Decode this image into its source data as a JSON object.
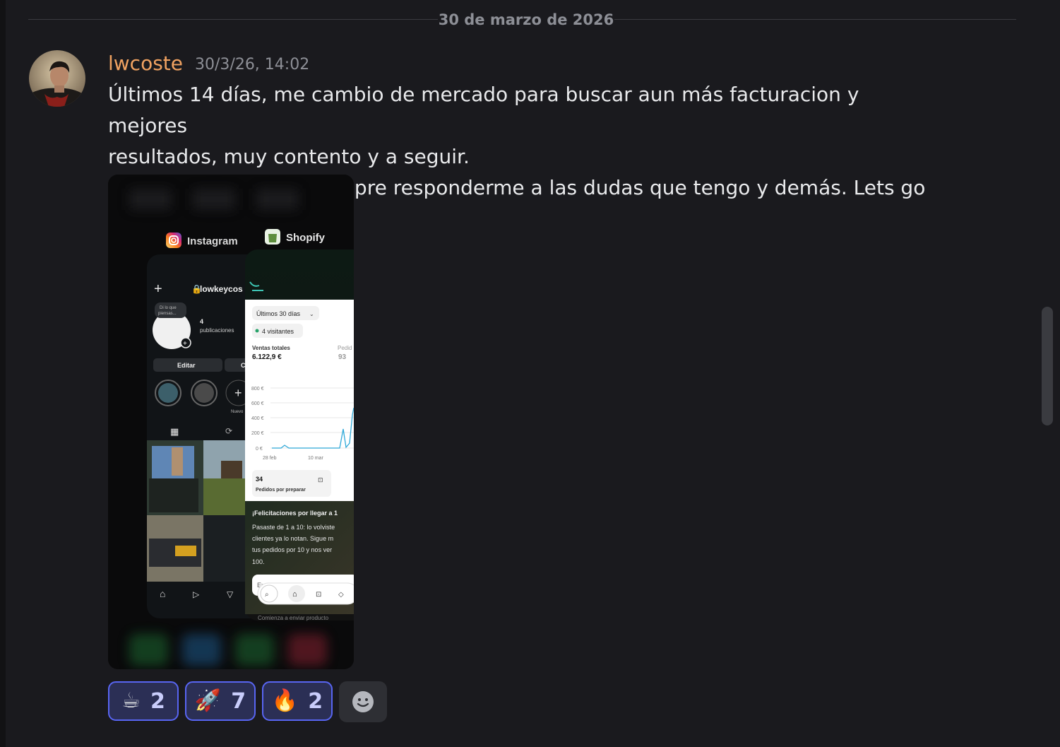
{
  "divider": {
    "date": "30 de marzo de 2026"
  },
  "message": {
    "author": "lwcoste",
    "timestamp": "30/3/26, 14:02",
    "lines": [
      "Últimos 14 días, me cambio de mercado para buscar aun más facturacion y mejores",
      "resultados, muy contento y a seguir.",
      "Gracias a todos por siempre responderme a las dudas que tengo y demás. Lets go"
    ]
  },
  "attachment": {
    "instagram": {
      "app_label": "Instagram",
      "username": "lowkeycos",
      "note": "Di lo que piensas...",
      "posts_count": "4",
      "posts_label": "publicaciones",
      "edit_label": "Editar",
      "edit_partial": "C",
      "new_label": "Nuevo"
    },
    "shopify": {
      "app_label": "Shopify",
      "period": "Últimos 30 días",
      "visitors": "4 visitantes",
      "sales_label": "Ventas totales",
      "sales_value": "6.122,9 €",
      "orders_partial_label": "Pedid",
      "orders_partial_value": "93",
      "y_ticks": [
        "800 €",
        "600 €",
        "400 €",
        "200 €",
        "0 €"
      ],
      "x_ticks": [
        "28 feb",
        "10 mar"
      ],
      "pending_count": "34",
      "pending_label": "Pedidos por preparar",
      "congrats_title": "¡Felicitaciones por llegar a 1",
      "congrats_body": [
        "Pasaste de 1 a 10: lo volviste",
        "clientes ya lo notan. Sigue m",
        "tus pedidos por 10 y nos ver",
        "100."
      ],
      "explore_partial": "Explorar",
      "bottom_partial": "Comienza a enviar producto"
    }
  },
  "reactions": [
    {
      "emoji": "☕",
      "name": "coffee",
      "count": "2"
    },
    {
      "emoji": "🚀",
      "name": "rocket",
      "count": "7"
    },
    {
      "emoji": "🔥",
      "name": "fire",
      "count": "2"
    }
  ],
  "colors": {
    "background": "#1a1a1e",
    "username": "#f0a261",
    "reaction_border": "#5865f2",
    "reaction_bg": "#2b2f55",
    "chart_line": "#2ea8d8"
  }
}
